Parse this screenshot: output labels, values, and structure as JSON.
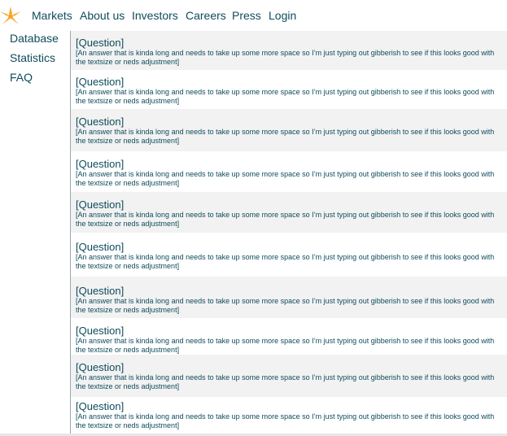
{
  "nav": {
    "logo": "sun-logo",
    "items": [
      {
        "label": "Markets"
      },
      {
        "label": "About us"
      },
      {
        "label": "Investors"
      },
      {
        "label": "Careers"
      },
      {
        "label": "Press"
      },
      {
        "label": "Login"
      }
    ]
  },
  "sidebar": {
    "items": [
      {
        "label": "Database"
      },
      {
        "label": "Statistics"
      },
      {
        "label": "FAQ"
      }
    ]
  },
  "faq": {
    "items": [
      {
        "question": "[Question]",
        "answer": "[An answer that is kinda long and needs to take up some more space so I’m just typing out gibberish to see if this looks good with the textsize or neds adjustment]"
      },
      {
        "question": "[Question]",
        "answer": "[An answer that is kinda long and needs to take up some more space so I’m just typing out gibberish to see if this looks good with the textsize or neds adjustment]"
      },
      {
        "question": "[Question]",
        "answer": "[An answer that is kinda long and needs to take up some more space so I’m just typing out gibberish to see if this looks good with the textsize or neds adjustment]"
      },
      {
        "question": "[Question]",
        "answer": "[An answer that is kinda long and needs to take up some more space so I’m just typing out gibberish to see if this looks good with the textsize or neds adjustment]"
      },
      {
        "question": "[Question]",
        "answer": "[An answer that is kinda long and needs to take up some more space so I’m just typing out gibberish to see if this looks good with the textsize or neds adjustment]"
      },
      {
        "question": "[Question]",
        "answer": "[An answer that is kinda long and needs to take up some more space so I’m just typing out gibberish to see if this looks good with the textsize or neds adjustment]"
      },
      {
        "question": "[Question]",
        "answer": "[An answer that is kinda long and needs to take up some more space so I’m just typing out gibberish to see if this looks good with the textsize or neds adjustment]"
      },
      {
        "question": "[Question]",
        "answer": "[An answer that is kinda long and needs to take up some more space so I’m just typing out gibberish to see if this looks good with the textsize or neds adjustment]"
      },
      {
        "question": "[Question]",
        "answer": "[An answer that is kinda long and needs to take up some more space so I’m just typing out gibberish to see if this looks good with the textsize or neds adjustment]"
      },
      {
        "question": "[Question]",
        "answer": "[An answer that is kinda long and needs to take up some more space so I’m just typing out gibberish to see if this looks good with the textsize or neds adjustment]"
      }
    ]
  },
  "colors": {
    "text": "#0f4c5c",
    "logo": "#f5a623",
    "row_shade": "#f2f2f2",
    "divider": "#9aa9ad"
  }
}
